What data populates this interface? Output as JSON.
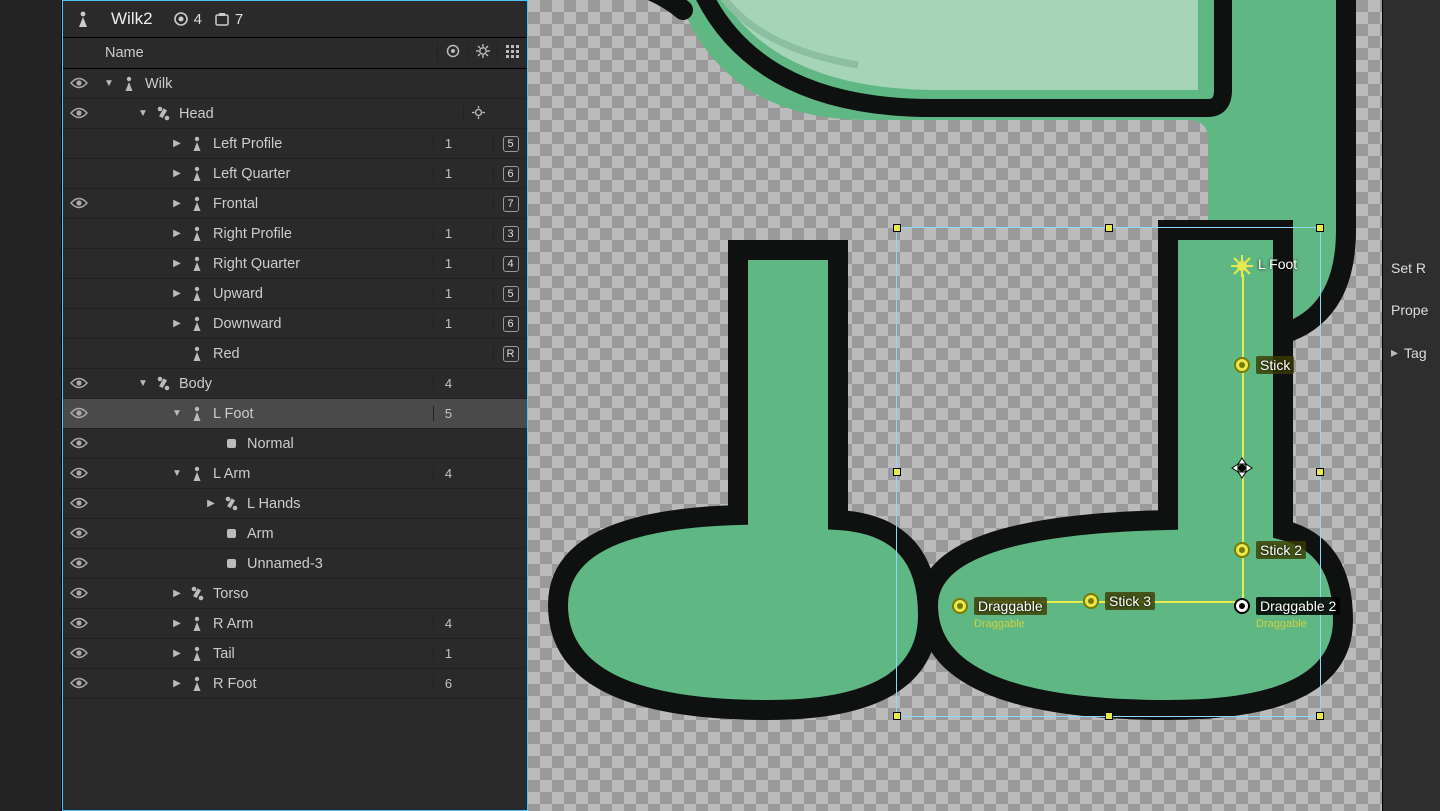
{
  "header": {
    "title": "Wilk2",
    "eye_count": "4",
    "frame_count": "7"
  },
  "columns": {
    "name": "Name"
  },
  "tree": [
    {
      "eye": true,
      "depth": 0,
      "arrow": "down",
      "icon": "figure",
      "label": "Wilk",
      "c1": "",
      "c2": "",
      "key": ""
    },
    {
      "eye": true,
      "depth": 1,
      "arrow": "down",
      "icon": "bone",
      "label": "Head",
      "c1": "",
      "c2": "gear",
      "key": ""
    },
    {
      "eye": false,
      "depth": 2,
      "arrow": "right",
      "icon": "figure",
      "label": "Left Profile",
      "c1": "1",
      "c2": "",
      "key": "5"
    },
    {
      "eye": false,
      "depth": 2,
      "arrow": "right",
      "icon": "figure",
      "label": "Left Quarter",
      "c1": "1",
      "c2": "",
      "key": "6"
    },
    {
      "eye": true,
      "depth": 2,
      "arrow": "right",
      "icon": "figure",
      "label": "Frontal",
      "c1": "",
      "c2": "",
      "key": "7"
    },
    {
      "eye": false,
      "depth": 2,
      "arrow": "right",
      "icon": "figure",
      "label": "Right Profile",
      "c1": "1",
      "c2": "",
      "key": "3"
    },
    {
      "eye": false,
      "depth": 2,
      "arrow": "right",
      "icon": "figure",
      "label": "Right Quarter",
      "c1": "1",
      "c2": "",
      "key": "4"
    },
    {
      "eye": false,
      "depth": 2,
      "arrow": "right",
      "icon": "figure",
      "label": "Upward",
      "c1": "1",
      "c2": "",
      "key": "5"
    },
    {
      "eye": false,
      "depth": 2,
      "arrow": "right",
      "icon": "figure",
      "label": "Downward",
      "c1": "1",
      "c2": "",
      "key": "6"
    },
    {
      "eye": false,
      "depth": 2,
      "arrow": "",
      "icon": "figure",
      "label": "Red",
      "c1": "",
      "c2": "",
      "key": "R"
    },
    {
      "eye": true,
      "depth": 1,
      "arrow": "down",
      "icon": "bone",
      "label": "Body",
      "c1": "4",
      "c2": "",
      "key": ""
    },
    {
      "eye": true,
      "depth": 2,
      "arrow": "down",
      "icon": "figure",
      "label": "L Foot",
      "c1": "5",
      "c2": "",
      "key": "",
      "selected": true
    },
    {
      "eye": true,
      "depth": 3,
      "arrow": "",
      "icon": "layer",
      "label": "Normal",
      "c1": "",
      "c2": "",
      "key": ""
    },
    {
      "eye": true,
      "depth": 2,
      "arrow": "down",
      "icon": "figure",
      "label": "L Arm",
      "c1": "4",
      "c2": "",
      "key": ""
    },
    {
      "eye": true,
      "depth": 3,
      "arrow": "right",
      "icon": "bone",
      "label": "L Hands",
      "c1": "",
      "c2": "",
      "key": ""
    },
    {
      "eye": true,
      "depth": 3,
      "arrow": "",
      "icon": "layer",
      "label": "Arm",
      "c1": "",
      "c2": "",
      "key": ""
    },
    {
      "eye": true,
      "depth": 3,
      "arrow": "",
      "icon": "layer",
      "label": "Unnamed-3",
      "c1": "",
      "c2": "",
      "key": ""
    },
    {
      "eye": true,
      "depth": 2,
      "arrow": "right",
      "icon": "bone",
      "label": "Torso",
      "c1": "",
      "c2": "",
      "key": ""
    },
    {
      "eye": true,
      "depth": 2,
      "arrow": "right",
      "icon": "figure",
      "label": "R Arm",
      "c1": "4",
      "c2": "",
      "key": ""
    },
    {
      "eye": true,
      "depth": 2,
      "arrow": "right",
      "icon": "figure",
      "label": "Tail",
      "c1": "1",
      "c2": "",
      "key": ""
    },
    {
      "eye": true,
      "depth": 2,
      "arrow": "right",
      "icon": "figure",
      "label": "R Foot",
      "c1": "6",
      "c2": "",
      "key": ""
    }
  ],
  "canvas": {
    "nodes": {
      "lfoot": {
        "label": "L Foot",
        "type": "sun"
      },
      "stick": {
        "label": "Stick"
      },
      "stick2": {
        "label": "Stick 2"
      },
      "stick3": {
        "label": "Stick 3"
      },
      "draggable": {
        "label": "Draggable",
        "sub": "Draggable"
      },
      "draggable2": {
        "label": "Draggable 2",
        "sub": "Draggable"
      }
    }
  },
  "right": {
    "set": "Set R",
    "props": "Prope",
    "tag": "Tag"
  },
  "colors": {
    "body": "#5fb884",
    "belly": "#a6d4b7",
    "outline": "#0e110f"
  }
}
